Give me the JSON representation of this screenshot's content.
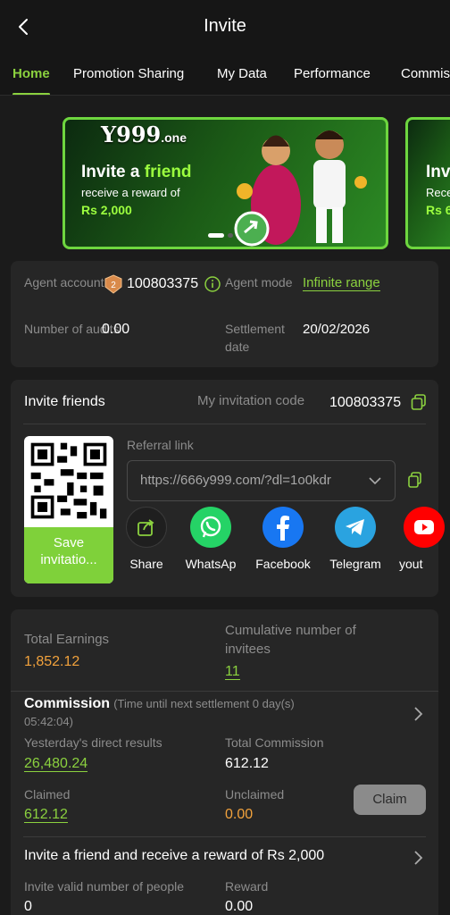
{
  "header": {
    "title": "Invite"
  },
  "tabs": [
    "Home",
    "Promotion Sharing",
    "My Data",
    "Performance",
    "Commis"
  ],
  "banner": {
    "logo_main": "Y999",
    "logo_suffix": ".one",
    "title_prefix": "Invite a ",
    "title_highlight": "friend",
    "subtitle": "receive a reward of",
    "amount": "Rs 2,000",
    "next_title": "Inv",
    "next_sub": "Rece",
    "next_amount": "Rs 6"
  },
  "agent": {
    "account_label": "Agent account",
    "account_value": "100803375",
    "mode_label": "Agent mode",
    "mode_value": "Infinite range",
    "audits_label": "Number of audits",
    "audits_value": "0.00",
    "settlement_label": "Settlement date",
    "settlement_value": "20/02/2026",
    "badge_level": "2"
  },
  "invite": {
    "title": "Invite friends",
    "code_label": "My invitation code",
    "code_value": "100803375",
    "referral_label": "Referral link",
    "referral_value": "https://666y999.com/?dl=1o0kdr",
    "save_label": "Save invitatio...",
    "share": [
      {
        "label": "Share",
        "color": "#1f1f1f"
      },
      {
        "label": "WhatsAp",
        "color": "#25d366"
      },
      {
        "label": "Facebook",
        "color": "#1877f2"
      },
      {
        "label": "Telegram",
        "color": "#2aa3e0"
      },
      {
        "label": "yout",
        "color": "#ff0000"
      }
    ]
  },
  "earnings": {
    "total_label": "Total Earnings",
    "total_value": "1,852.12",
    "invitees_label": "Cumulative number of invitees",
    "invitees_value": "11"
  },
  "commission": {
    "title": "Commission",
    "countdown": "(Time until next settlement  0 day(s) 05:42:04)",
    "direct_label": "Yesterday's direct results",
    "direct_value": "26,480.24",
    "total_label": "Total Commission",
    "total_value": "612.12",
    "claimed_label": "Claimed",
    "claimed_value": "612.12",
    "unclaimed_label": "Unclaimed",
    "unclaimed_value": "0.00",
    "claim_button": "Claim"
  },
  "reward": {
    "title": "Invite a friend and receive a reward of Rs 2,000",
    "valid_label": "Invite valid number of people",
    "valid_value": "0",
    "reward_label": "Reward",
    "reward_value": "0.00"
  }
}
